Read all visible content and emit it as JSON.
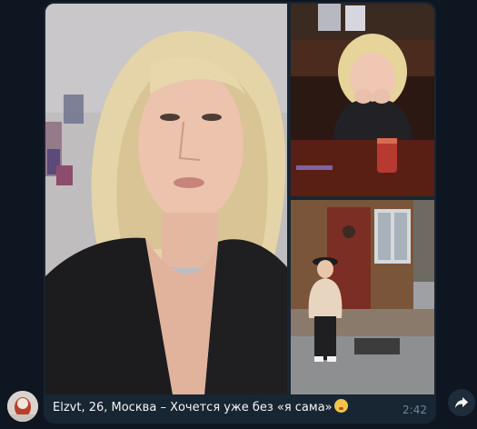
{
  "message": {
    "caption": "Elzvt, 26, Москва – Хочется уже без «я сама»",
    "time": "2:42",
    "emoji": "shushing-face"
  },
  "icons": {
    "share": "share-arrow-icon",
    "avatar": "avatar"
  },
  "colors": {
    "background": "#0e1621",
    "bubble": "#182533",
    "time": "#6d8799"
  }
}
